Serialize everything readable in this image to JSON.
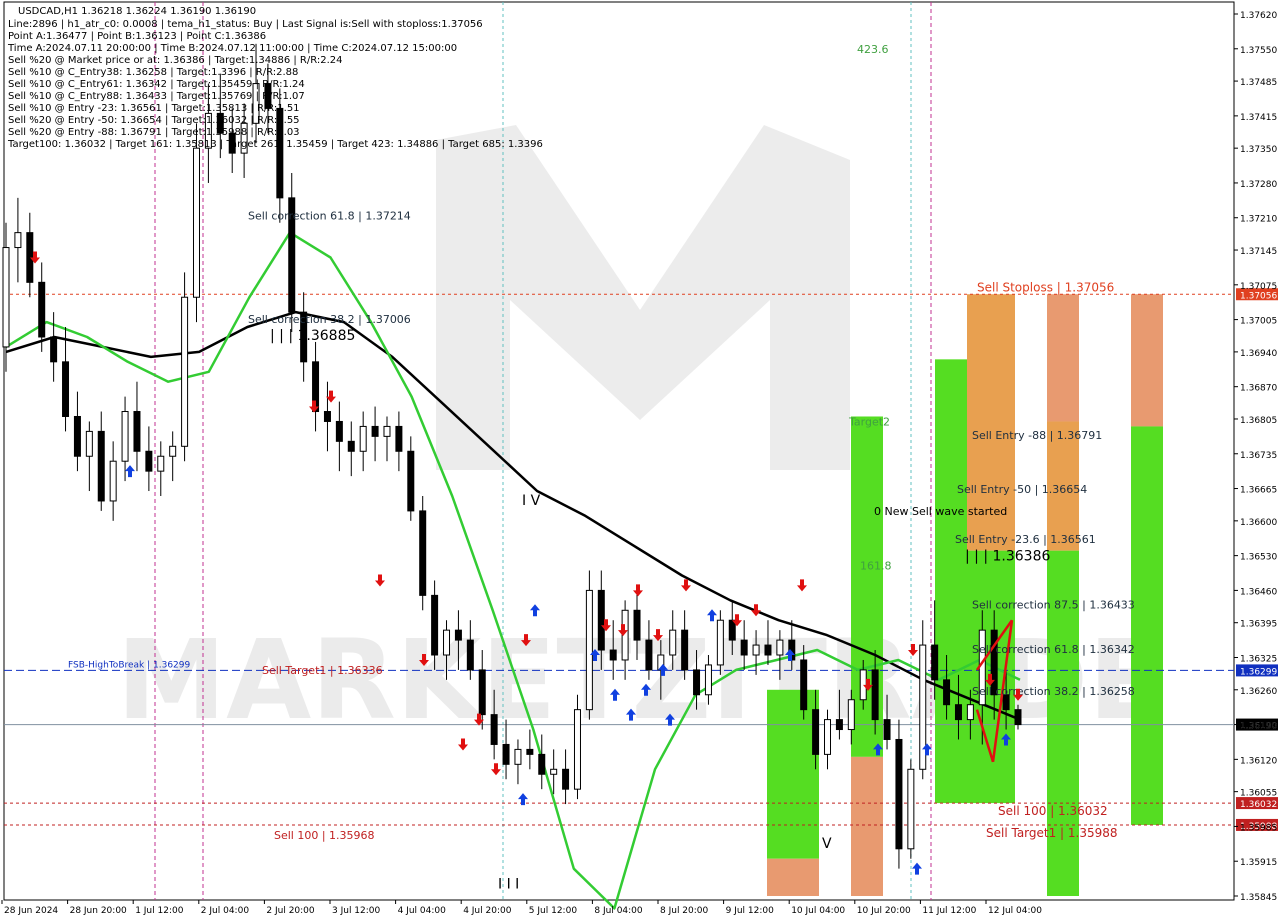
{
  "symbol_header": "USDCAD,H1  1.36218 1.36224 1.36190 1.36190",
  "info_lines": [
    "Line:2896  |  h1_atr_c0: 0.0008  |  tema_h1_status: Buy  |  Last Signal is:Sell with stoploss:1.37056",
    "Point A:1.36477  |  Point B:1.36123  |  Point C:1.36386",
    "Time A:2024.07.11 20:00:00  |  Time B:2024.07.12 11:00:00  |  Time C:2024.07.12 15:00:00",
    "Sell %20 @ Market price or at: 1.36386  |  Target:1.34886  |  R/R:2.24",
    "Sell %10 @ C_Entry38: 1.36258  |  Target:1.3396  |  R/R:2.88",
    "Sell %10 @ C_Entry61: 1.36342  |  Target:1.35459  |  R/R:1.24",
    "Sell %10 @ C_Entry88: 1.36433  |  Target:1.35769  |  R/R:1.07",
    "Sell %10 @ Entry -23: 1.36561  |  Target:1.35813  |  R/R:1.51",
    "Sell %20 @ Entry -50: 1.36654  |  Target:1.36032  |  R/R:1.55",
    "Sell %20 @ Entry -88: 1.36791  |  Target:1.35988  |  R/R:3.03",
    "Target100: 1.36032  |  Target 161: 1.35813  |  Target 261: 1.35459  |  Target 423: 1.34886  |  Target 685: 1.3396"
  ],
  "watermark": "MARKETZITRADE",
  "chart_data": {
    "type": "candlestick",
    "symbol": "USDCAD",
    "timeframe": "H1",
    "ylim": [
      1.35845,
      1.3762
    ],
    "price_ticks": [
      "1.37620",
      "1.37550",
      "1.37485",
      "1.37415",
      "1.37350",
      "1.37280",
      "1.37210",
      "1.37145",
      "1.37075",
      "1.37005",
      "1.36940",
      "1.36870",
      "1.36805",
      "1.36735",
      "1.36665",
      "1.36600",
      "1.36530",
      "1.36460",
      "1.36395",
      "1.36325",
      "1.36260",
      "1.36190",
      "1.36120",
      "1.36055",
      "1.35985",
      "1.35915",
      "1.35845"
    ],
    "time_ticks": [
      "28 Jun 2024",
      "28 Jun 20:00",
      "1 Jul 12:00",
      "2 Jul 04:00",
      "2 Jul 20:00",
      "3 Jul 12:00",
      "4 Jul 04:00",
      "4 Jul 20:00",
      "5 Jul 12:00",
      "8 Jul 04:00",
      "8 Jul 20:00",
      "9 Jul 12:00",
      "10 Jul 04:00",
      "10 Jul 20:00",
      "11 Jul 12:00",
      "12 Jul 04:00"
    ],
    "horizontal_levels": [
      {
        "name": "Sell Stoploss",
        "value": 1.37056,
        "label": "Sell Stoploss | 1.37056",
        "axis_label": "1.37056",
        "color": "#e04020"
      },
      {
        "name": "FSB-HighToBreak",
        "value": 1.36299,
        "label": "FSB-HighToBreak | 1.36299",
        "axis_label": "1.36299",
        "color": "#1030c0"
      },
      {
        "name": "current price",
        "value": 1.3619,
        "axis_label": "1.36190",
        "color": "#000000"
      },
      {
        "name": "Sell 100",
        "value": 1.36032,
        "label": "Sell 100 | 1.36032",
        "axis_label": "1.36032",
        "color": "#c02020"
      },
      {
        "name": "Sell Target1",
        "value": 1.35988,
        "label": "Sell Target1 | 1.35988",
        "axis_label": "1.35988",
        "color": "#c02020"
      }
    ],
    "annotations": [
      {
        "text": "Sell correction 61.8 | 1.37214",
        "price": 1.37214,
        "color": "#203040"
      },
      {
        "text": "Sell correction 38.2 | 1.37006",
        "price": 1.37006,
        "color": "#203040"
      },
      {
        "text": "| | | 1.36885",
        "price": 1.36972,
        "color": "#000000"
      },
      {
        "text": "I V",
        "price": 1.3664,
        "color": "#000000"
      },
      {
        "text": "Sell Target1 | 1.36336",
        "price": 1.363,
        "color": "#c02020"
      },
      {
        "text": "Sell 100 | 1.35968",
        "price": 1.35968,
        "color": "#c02020"
      },
      {
        "text": "I I I",
        "price": 1.35868,
        "color": "#000000"
      },
      {
        "text": "423.6",
        "price": 1.3755,
        "color": "#40a040"
      },
      {
        "text": "Target2",
        "price": 1.368,
        "color": "#40a040"
      },
      {
        "text": "161.8",
        "price": 1.3651,
        "color": "#40a040"
      },
      {
        "text": "0 New Sell wave started",
        "price": 1.3662,
        "color": "#000000"
      },
      {
        "text": "Sell Entry -88 | 1.36791",
        "price": 1.36773,
        "color": "#203040"
      },
      {
        "text": "Sell Entry -50 | 1.36654",
        "price": 1.36664,
        "color": "#203040"
      },
      {
        "text": "Sell Entry -23.6 | 1.36561",
        "price": 1.36563,
        "color": "#203040"
      },
      {
        "text": "| | | 1.36386",
        "price": 1.36528,
        "color": "#000000"
      },
      {
        "text": "Sell correction 87.5 | 1.36433",
        "price": 1.36432,
        "color": "#203040"
      },
      {
        "text": "Sell correction 61.8 | 1.36342",
        "price": 1.36342,
        "color": "#203040"
      },
      {
        "text": "Sell correction 38.2 | 1.36258",
        "price": 1.36258,
        "color": "#203040"
      },
      {
        "text": "V",
        "price": 1.3595,
        "color": "#000000"
      }
    ],
    "target_bars": [
      {
        "t0": 767,
        "t1": 819,
        "levels": [
          1.3626,
          1.3592,
          1.35845
        ],
        "colors": [
          "#55dd22",
          "#e89a70"
        ]
      },
      {
        "t0": 851,
        "t1": 883,
        "levels": [
          1.3681,
          1.36125,
          1.35845
        ],
        "colors": [
          "#55dd22",
          "#e89a70"
        ]
      },
      {
        "t0": 935,
        "t1": 967,
        "levels": [
          1.36925,
          1.36032
        ],
        "colors": [
          "#55dd22"
        ]
      },
      {
        "t0": 967,
        "t1": 1015,
        "levels": [
          1.37056,
          1.3654,
          1.36032
        ],
        "colors": [
          "#e8a050",
          "#55dd22"
        ]
      },
      {
        "t0": 1047,
        "t1": 1079,
        "levels": [
          1.37056,
          1.368,
          1.3654,
          1.35845
        ],
        "colors": [
          "#e89a70",
          "#e8a050",
          "#55dd22"
        ]
      },
      {
        "t0": 1131,
        "t1": 1163,
        "levels": [
          1.37056,
          1.3679,
          1.35988
        ],
        "colors": [
          "#e89a70",
          "#55dd22"
        ]
      }
    ],
    "trend_segments": [
      {
        "from": [
          977,
          1.363
        ],
        "to": [
          1012,
          1.364
        ],
        "color": "#e01010"
      },
      {
        "from": [
          977,
          1.3622
        ],
        "to": [
          993,
          1.36115
        ],
        "color": "#e01010"
      },
      {
        "from": [
          993,
          1.36115
        ],
        "to": [
          1012,
          1.364
        ],
        "color": "#e01010"
      }
    ],
    "series": {
      "ohlc": [
        [
          1.3695,
          1.372,
          1.369,
          1.3715
        ],
        [
          1.3715,
          1.3725,
          1.3708,
          1.3718
        ],
        [
          1.3718,
          1.3722,
          1.3705,
          1.3708
        ],
        [
          1.3708,
          1.3712,
          1.3694,
          1.3697
        ],
        [
          1.3697,
          1.3702,
          1.3688,
          1.3692
        ],
        [
          1.3692,
          1.3699,
          1.3678,
          1.3681
        ],
        [
          1.3681,
          1.3686,
          1.367,
          1.3673
        ],
        [
          1.3673,
          1.368,
          1.3666,
          1.3678
        ],
        [
          1.3678,
          1.3682,
          1.3662,
          1.3664
        ],
        [
          1.3664,
          1.3676,
          1.366,
          1.3672
        ],
        [
          1.3672,
          1.3685,
          1.3668,
          1.3682
        ],
        [
          1.3682,
          1.3688,
          1.367,
          1.3674
        ],
        [
          1.3674,
          1.3679,
          1.3666,
          1.367
        ],
        [
          1.367,
          1.3676,
          1.3665,
          1.3673
        ],
        [
          1.3673,
          1.3678,
          1.3668,
          1.3675
        ],
        [
          1.3675,
          1.371,
          1.3672,
          1.3705
        ],
        [
          1.3705,
          1.374,
          1.37,
          1.3735
        ],
        [
          1.3735,
          1.3748,
          1.3728,
          1.3742
        ],
        [
          1.3742,
          1.375,
          1.3733,
          1.3738
        ],
        [
          1.3738,
          1.3743,
          1.373,
          1.3734
        ],
        [
          1.3734,
          1.3744,
          1.3729,
          1.374
        ],
        [
          1.374,
          1.3756,
          1.3736,
          1.3748
        ],
        [
          1.3748,
          1.3752,
          1.3738,
          1.3743
        ],
        [
          1.3743,
          1.3747,
          1.372,
          1.3725
        ],
        [
          1.3725,
          1.373,
          1.3698,
          1.3702
        ],
        [
          1.3702,
          1.3706,
          1.3688,
          1.3692
        ],
        [
          1.3692,
          1.3696,
          1.3678,
          1.3682
        ],
        [
          1.3682,
          1.3688,
          1.3674,
          1.368
        ],
        [
          1.368,
          1.3684,
          1.367,
          1.3676
        ],
        [
          1.3676,
          1.368,
          1.3669,
          1.3674
        ],
        [
          1.3674,
          1.3682,
          1.367,
          1.3679
        ],
        [
          1.3679,
          1.3683,
          1.3672,
          1.3677
        ],
        [
          1.3677,
          1.3681,
          1.3672,
          1.3679
        ],
        [
          1.3679,
          1.3682,
          1.367,
          1.3674
        ],
        [
          1.3674,
          1.3677,
          1.366,
          1.3662
        ],
        [
          1.3662,
          1.3665,
          1.3642,
          1.3645
        ],
        [
          1.3645,
          1.3648,
          1.363,
          1.3633
        ],
        [
          1.3633,
          1.364,
          1.3628,
          1.3638
        ],
        [
          1.3638,
          1.3642,
          1.363,
          1.3636
        ],
        [
          1.3636,
          1.364,
          1.3628,
          1.363
        ],
        [
          1.363,
          1.3634,
          1.3618,
          1.3621
        ],
        [
          1.3621,
          1.3626,
          1.3612,
          1.3615
        ],
        [
          1.3615,
          1.362,
          1.3608,
          1.3611
        ],
        [
          1.3611,
          1.3616,
          1.3607,
          1.3614
        ],
        [
          1.3614,
          1.3618,
          1.361,
          1.3613
        ],
        [
          1.3613,
          1.3617,
          1.3606,
          1.3609
        ],
        [
          1.3609,
          1.3614,
          1.3605,
          1.361
        ],
        [
          1.361,
          1.3614,
          1.3603,
          1.3606
        ],
        [
          1.3606,
          1.3625,
          1.3604,
          1.3622
        ],
        [
          1.3622,
          1.365,
          1.362,
          1.3646
        ],
        [
          1.3646,
          1.365,
          1.363,
          1.3634
        ],
        [
          1.3634,
          1.364,
          1.3628,
          1.3632
        ],
        [
          1.3632,
          1.3644,
          1.3628,
          1.3642
        ],
        [
          1.3642,
          1.3646,
          1.3632,
          1.3636
        ],
        [
          1.3636,
          1.364,
          1.3628,
          1.363
        ],
        [
          1.363,
          1.3636,
          1.3624,
          1.3633
        ],
        [
          1.3633,
          1.3642,
          1.363,
          1.3638
        ],
        [
          1.3638,
          1.3642,
          1.3628,
          1.363
        ],
        [
          1.363,
          1.3634,
          1.3622,
          1.3625
        ],
        [
          1.3625,
          1.3633,
          1.3623,
          1.3631
        ],
        [
          1.3631,
          1.3642,
          1.3629,
          1.364
        ],
        [
          1.364,
          1.3644,
          1.3633,
          1.3636
        ],
        [
          1.3636,
          1.364,
          1.363,
          1.3633
        ],
        [
          1.3633,
          1.3638,
          1.3629,
          1.3635
        ],
        [
          1.3635,
          1.364,
          1.3631,
          1.3633
        ],
        [
          1.3633,
          1.3638,
          1.3628,
          1.3636
        ],
        [
          1.3636,
          1.364,
          1.363,
          1.3632
        ],
        [
          1.3632,
          1.3635,
          1.362,
          1.3622
        ],
        [
          1.3622,
          1.3626,
          1.361,
          1.3613
        ],
        [
          1.3613,
          1.3622,
          1.361,
          1.362
        ],
        [
          1.362,
          1.3626,
          1.3616,
          1.3618
        ],
        [
          1.3618,
          1.3626,
          1.3615,
          1.3624
        ],
        [
          1.3624,
          1.3632,
          1.3622,
          1.363
        ],
        [
          1.363,
          1.3634,
          1.3617,
          1.362
        ],
        [
          1.362,
          1.3625,
          1.3614,
          1.3616
        ],
        [
          1.3616,
          1.362,
          1.359,
          1.3594
        ],
        [
          1.3594,
          1.3612,
          1.3592,
          1.361
        ],
        [
          1.361,
          1.364,
          1.3608,
          1.3635
        ],
        [
          1.3635,
          1.3644,
          1.3624,
          1.3628
        ],
        [
          1.3628,
          1.3633,
          1.362,
          1.3623
        ],
        [
          1.3623,
          1.3629,
          1.3616,
          1.362
        ],
        [
          1.362,
          1.3626,
          1.3616,
          1.3623
        ],
        [
          1.3623,
          1.3642,
          1.3615,
          1.3638
        ],
        [
          1.3638,
          1.3642,
          1.362,
          1.3625
        ],
        [
          1.3625,
          1.363,
          1.3618,
          1.3622
        ],
        [
          1.3622,
          1.3623,
          1.3618,
          1.3619
        ]
      ],
      "ma_fast_green": [
        1.3695,
        1.37,
        1.3697,
        1.3692,
        1.3688,
        1.369,
        1.3705,
        1.3718,
        1.3713,
        1.37,
        1.3685,
        1.3665,
        1.3642,
        1.3618,
        1.359,
        1.3582,
        1.361,
        1.3625,
        1.363,
        1.3632,
        1.3634,
        1.363,
        1.3632,
        1.3628,
        1.3632,
        1.3628
      ],
      "ma_slow_black": [
        1.3694,
        1.3697,
        1.3695,
        1.3693,
        1.3694,
        1.3699,
        1.3702,
        1.37,
        1.3693,
        1.3684,
        1.3675,
        1.3666,
        1.3661,
        1.3655,
        1.3649,
        1.3644,
        1.364,
        1.3637,
        1.3633,
        1.3628,
        1.3624,
        1.362
      ]
    }
  }
}
